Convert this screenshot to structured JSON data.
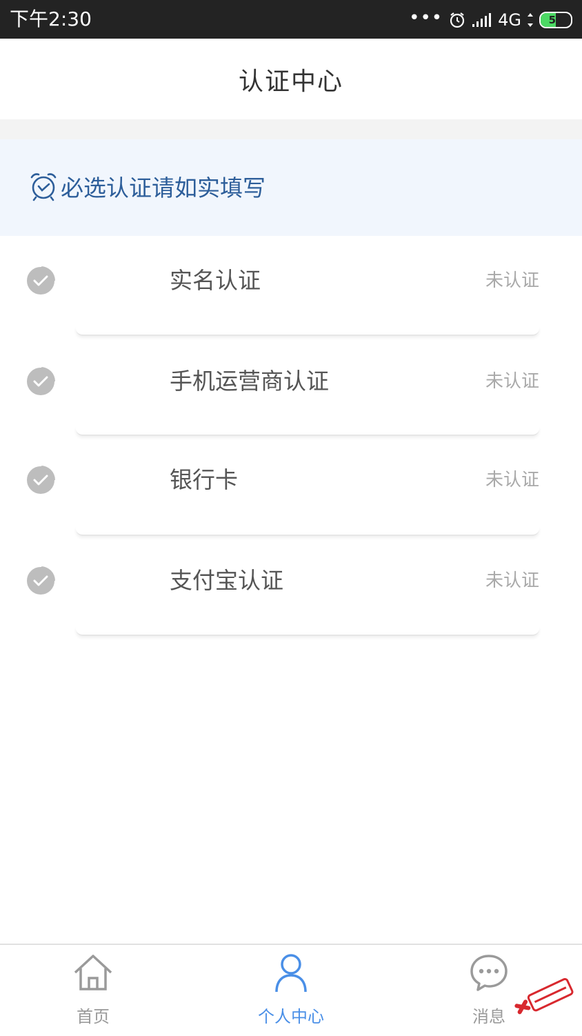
{
  "status_bar": {
    "time": "下午2:30",
    "dots": "•••",
    "network": "4G",
    "battery": "51"
  },
  "header": {
    "title": "认证中心"
  },
  "notice": {
    "text": "必选认证请如实填写",
    "icon": "alarm-clock-icon"
  },
  "items": [
    {
      "label": "实名认证",
      "status": "未认证"
    },
    {
      "label": "手机运营商认证",
      "status": "未认证"
    },
    {
      "label": "银行卡",
      "status": "未认证"
    },
    {
      "label": "支付宝认证",
      "status": "未认证"
    }
  ],
  "tabs": [
    {
      "label": "首页",
      "icon": "home-icon",
      "active": false
    },
    {
      "label": "个人中心",
      "icon": "person-icon",
      "active": true
    },
    {
      "label": "消息",
      "icon": "chat-bubble-icon",
      "active": false
    }
  ],
  "colors": {
    "accent": "#4a8fe7",
    "tab_inactive": "#9a9a9a",
    "notice_text": "#2d5e9a",
    "watermark": "#d8282e"
  }
}
